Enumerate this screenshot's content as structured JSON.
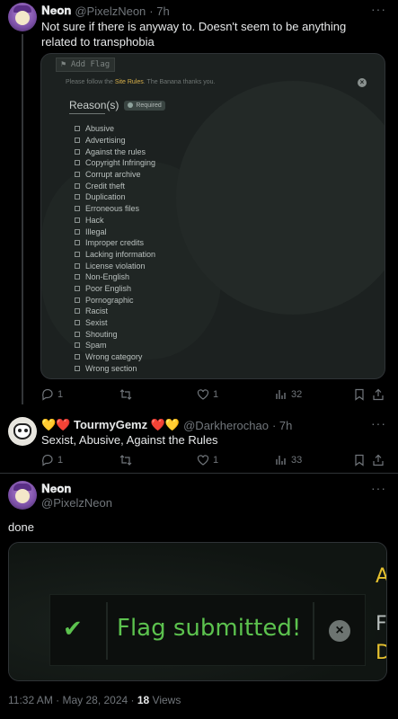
{
  "tweet1": {
    "name": "𝐍𝐞𝐨𝐧",
    "handle": "@PixelzNeon",
    "time": "· 7h",
    "text": "Not sure if there is anyway to. Doesn't seem to be anything related to transphobia",
    "more": "···",
    "stats": {
      "replies": "1",
      "likes": "1",
      "views": "32"
    }
  },
  "flag_dialog": {
    "button_label": "Add Flag",
    "note_before": "Please follow the ",
    "note_link": "Site Rules",
    "note_after": ". The Banana thanks you.",
    "reasons_title": "Reason(s)",
    "required_label": "Required",
    "reasons": [
      "Abusive",
      "Advertising",
      "Against the rules",
      "Copyright Infringing",
      "Corrupt archive",
      "Credit theft",
      "Duplication",
      "Erroneous files",
      "Hack",
      "Illegal",
      "Improper credits",
      "Lacking information",
      "License violation",
      "Non-English",
      "Poor English",
      "Pornographic",
      "Racist",
      "Sexist",
      "Shouting",
      "Spam",
      "Wrong category",
      "Wrong section"
    ]
  },
  "tweet2": {
    "name_prefix": "💛❤️",
    "name": "TourmyGemz",
    "name_suffix": "❤️💛",
    "handle": "@Darkherochao",
    "time": "· 7h",
    "text": "Sexist, Abusive, Against the Rules",
    "more": "···",
    "stats": {
      "replies": "1",
      "likes": "1",
      "views": "33"
    }
  },
  "tweet3": {
    "name": "𝐍𝐞𝐨𝐧",
    "handle": "@PixelzNeon",
    "more": "···",
    "text": "done",
    "toast_text": "Flag submitted!",
    "side_letters": [
      "A",
      "F",
      "D"
    ],
    "timestamp": "11:32 AM · May 28, 2024 · ",
    "views_count": "18",
    "views_label": " Views"
  },
  "colors": {
    "accent_green": "#5cc24e",
    "link_yellow": "#d8b04a",
    "muted": "#71767b"
  }
}
